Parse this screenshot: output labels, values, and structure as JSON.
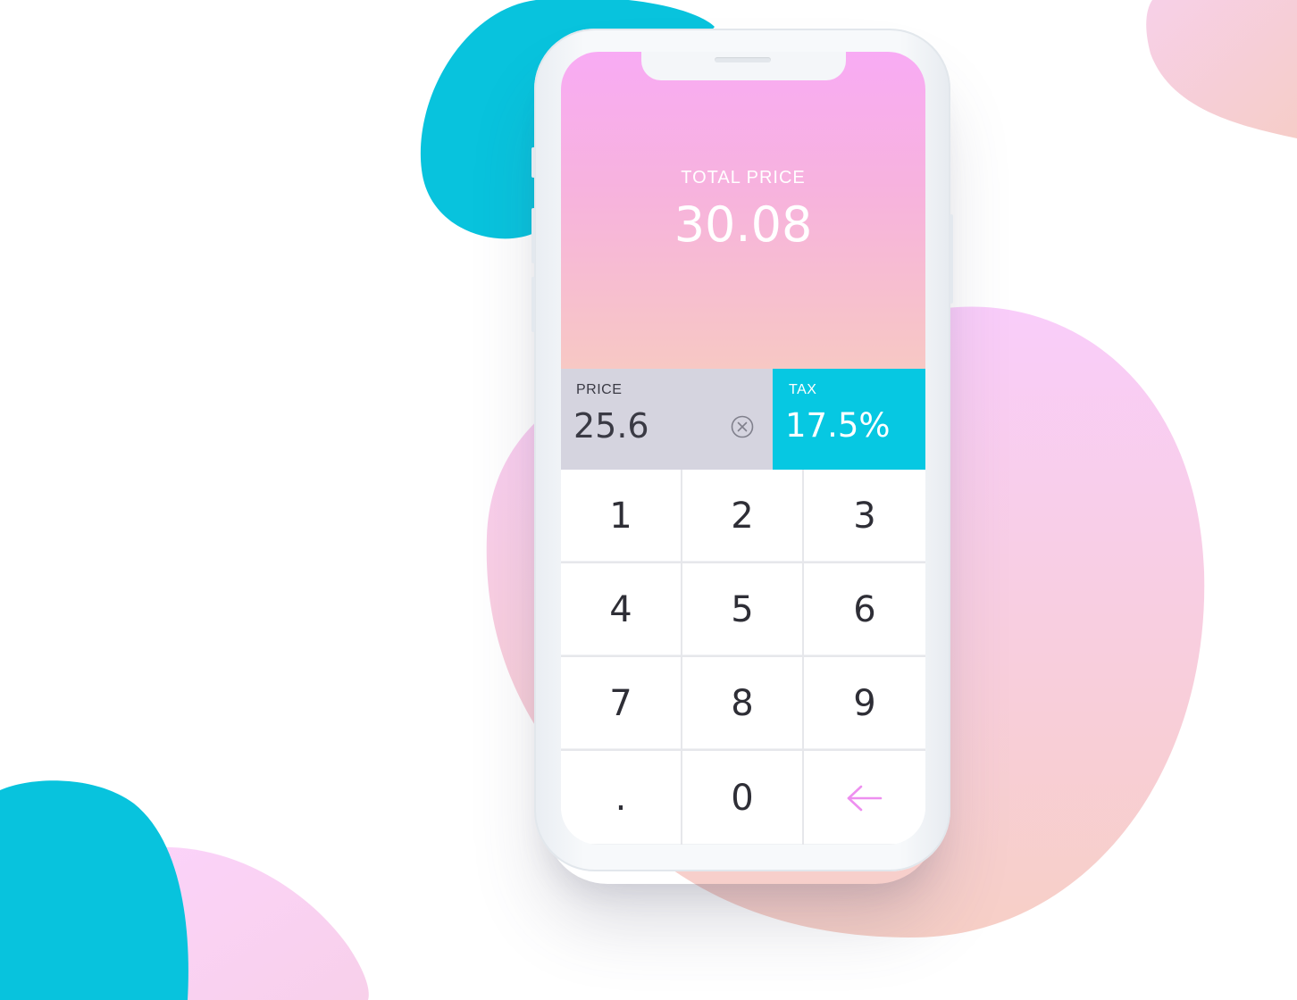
{
  "colors": {
    "accent_cyan": "#06c8e2",
    "header_gradient_top": "#f8abf4",
    "header_gradient_bottom": "#f7c8c4",
    "price_box_bg": "#d5d4df",
    "backspace_color": "#ee8ff0"
  },
  "header": {
    "total_label": "TOTAL PRICE",
    "total_value": "30.08"
  },
  "price": {
    "label": "PRICE",
    "value": "25.6",
    "clear_icon": "close-circle-icon"
  },
  "tax": {
    "label": "TAX",
    "value": "17.5%"
  },
  "keypad": {
    "keys": [
      {
        "label": "1"
      },
      {
        "label": "2"
      },
      {
        "label": "3"
      },
      {
        "label": "4"
      },
      {
        "label": "5"
      },
      {
        "label": "6"
      },
      {
        "label": "7"
      },
      {
        "label": "8"
      },
      {
        "label": "9"
      },
      {
        "label": "."
      },
      {
        "label": "0"
      },
      {
        "label": "",
        "icon": "backspace-arrow-icon"
      }
    ]
  }
}
